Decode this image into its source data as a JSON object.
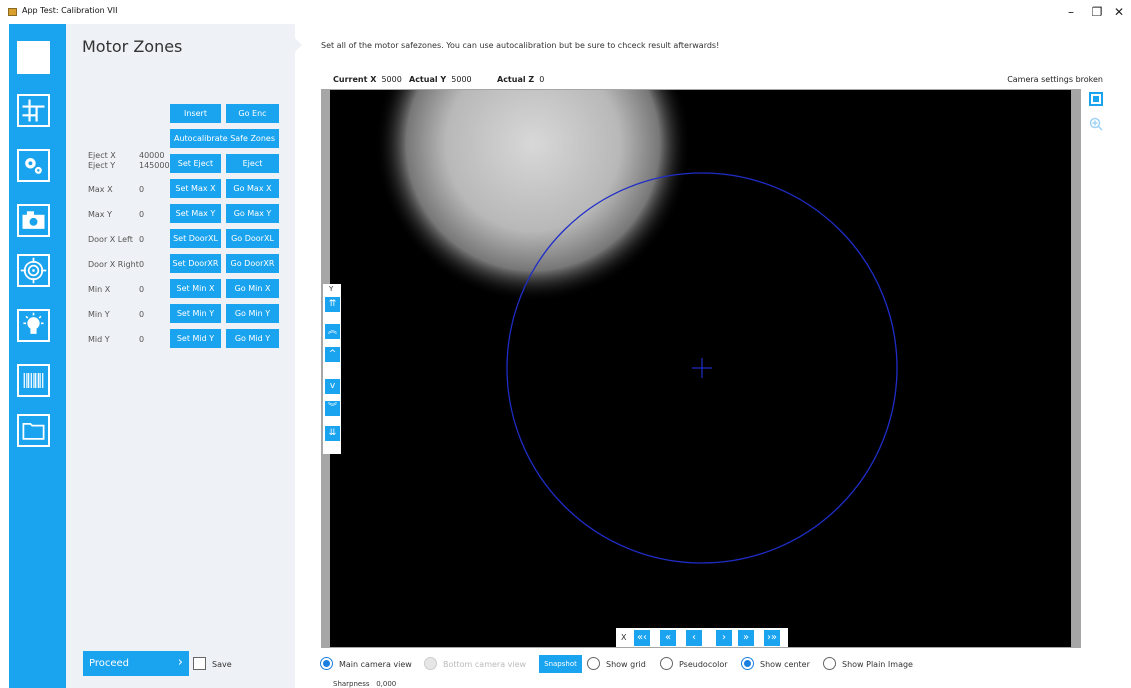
{
  "window": {
    "title": "App Test: Calibration VII",
    "controls": {
      "minimize": "–",
      "maximize": "❐",
      "close": "✕"
    }
  },
  "nav": {
    "items": [
      "home",
      "layout-icon",
      "gears-icon",
      "camera-icon",
      "target-icon",
      "lightbulb-icon",
      "barcode-icon",
      "folder-icon"
    ],
    "active": "gears-icon"
  },
  "panel": {
    "title": "Motor Zones",
    "top_buttons": {
      "insert": "Insert",
      "go_enc": "Go Enc",
      "autocalibrate": "Autocalibrate Safe Zones"
    },
    "eject": {
      "label_x": "Eject X",
      "label_y": "Eject Y",
      "value_x": "40000",
      "value_y": "145000",
      "set": "Set Eject",
      "go": "Eject"
    },
    "rows": [
      {
        "label": "Max X",
        "value": "0",
        "set": "Set Max X",
        "go": "Go Max X"
      },
      {
        "label": "Max Y",
        "value": "0",
        "set": "Set Max Y",
        "go": "Go Max Y"
      },
      {
        "label": "Door X Left",
        "value": "0",
        "set": "Set DoorXL",
        "go": "Go DoorXL"
      },
      {
        "label": "Door X Right",
        "value": "0",
        "set": "Set DoorXR",
        "go": "Go DoorXR"
      },
      {
        "label": "Min X",
        "value": "0",
        "set": "Set Min X",
        "go": "Go Min X"
      },
      {
        "label": "Min Y",
        "value": "0",
        "set": "Set Min Y",
        "go": "Go Min Y"
      },
      {
        "label": "Mid Y",
        "value": "0",
        "set": "Set Mid Y",
        "go": "Go Mid Y"
      }
    ],
    "proceed": "Proceed",
    "proceed_chevron": "›",
    "save": "Save"
  },
  "main": {
    "instruction": "Set all of the motor safezones. You can use autocalibration but be sure to chceck result afterwards!",
    "coords": {
      "current_x_label": "Current X",
      "current_x": "5000",
      "actual_y_label": "Actual Y",
      "actual_y": "5000",
      "actual_z_label": "Actual Z",
      "actual_z": "0"
    },
    "camera_status": "Camera settings broken",
    "y_jog": {
      "label": "Y",
      "buttons": [
        "⇈",
        "︽",
        "^",
        "v",
        "︾",
        "⇊"
      ]
    },
    "x_jog": {
      "label": "X",
      "buttons": [
        "«‹",
        "«",
        "‹",
        "›",
        "»",
        "›»"
      ]
    },
    "options": {
      "main_camera": "Main camera view",
      "bottom_camera": "Bottom camera view",
      "snapshot": "Snapshot",
      "show_grid": "Show grid",
      "pseudocolor": "Pseudocolor",
      "show_center": "Show center",
      "show_plain": "Show Plain Image"
    },
    "sharpness_label": "Sharpness",
    "sharpness_value": "0,000"
  },
  "colors": {
    "accent": "#1aa3ef",
    "panel_bg": "#eef1f5",
    "overlay_circle": "#1f2dc8"
  }
}
